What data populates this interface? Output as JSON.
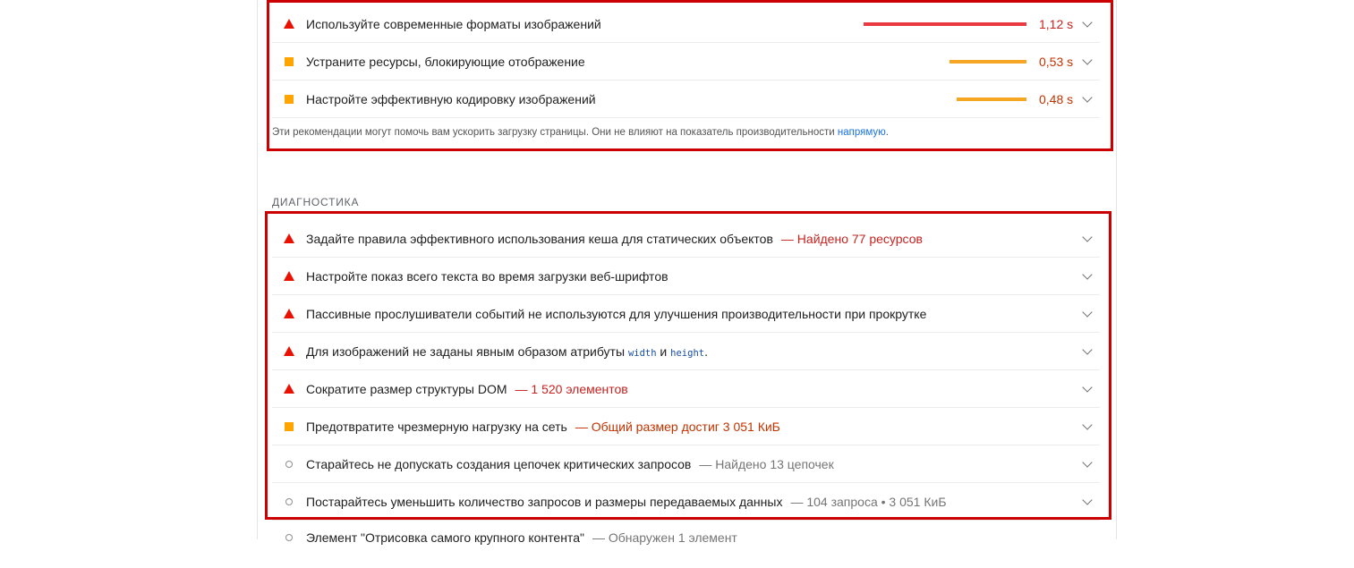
{
  "opportunities": [
    {
      "status": "fail",
      "title": "Используйте современные форматы изображений",
      "value": "1,12 s",
      "bar_fraction": 1.0
    },
    {
      "status": "average",
      "title": "Устраните ресурсы, блокирующие отображение",
      "value": "0,53 s",
      "bar_fraction": 0.47
    },
    {
      "status": "average",
      "title": "Настройте эффективную кодировку изображений",
      "value": "0,48 s",
      "bar_fraction": 0.43
    }
  ],
  "opportunities_note": {
    "text": "Эти рекомендации могут помочь вам ускорить загрузку страницы. Они не влияют на показатель производительности ",
    "link": "напрямую",
    "end": "."
  },
  "diagnostics_title": "ДИАГНОСТИКА",
  "diagnostics": [
    {
      "status": "fail",
      "title": "Задайте правила эффективного использования кеша для статических объектов",
      "display": "— Найдено 77 ресурсов"
    },
    {
      "status": "fail",
      "title": "Настройте показ всего текста во время загрузки веб-шрифтов",
      "display": ""
    },
    {
      "status": "fail",
      "title": "Пассивные прослушиватели событий не используются для улучшения производительности при прокрутке",
      "display": ""
    },
    {
      "status": "fail",
      "title_parts": [
        "Для изображений не заданы явным образом атрибуты ",
        "width",
        " и ",
        "height",
        "."
      ],
      "display": ""
    },
    {
      "status": "fail",
      "title": "Сократите размер структуры DOM",
      "display": "— 1 520 элементов"
    },
    {
      "status": "average",
      "title": "Предотвратите чрезмерную нагрузку на сеть",
      "display": "— Общий размер достиг 3 051 КиБ"
    },
    {
      "status": "informative",
      "title": "Старайтесь не допускать создания цепочек критических запросов",
      "display": "— Найдено 13 цепочек"
    },
    {
      "status": "informative",
      "title": "Постарайтесь уменьшить количество запросов и размеры передаваемых данных",
      "display": "— 104 запроса • 3 051 КиБ"
    }
  ],
  "partial_row": {
    "title": "Элемент \"Отрисовка самого крупного контента\"",
    "display": "— Обнаружен 1 элемент"
  },
  "colors": {
    "fail": "#eb0f00",
    "average": "#ffa400",
    "informative": "#8d8d8d",
    "highlight": "#cc0000",
    "link": "#1a73e8"
  },
  "icons": {
    "fail": "triangle-icon",
    "average": "square-icon",
    "informative": "circle-icon",
    "expand": "chevron-down-icon"
  }
}
